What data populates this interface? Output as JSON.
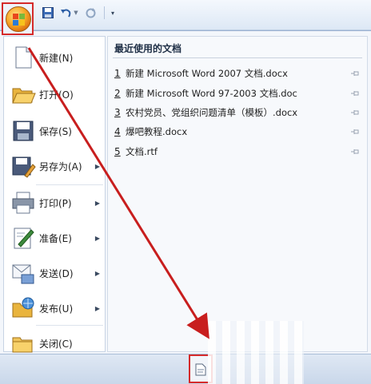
{
  "menu": {
    "items": [
      {
        "label": "新建(N)",
        "has_submenu": false
      },
      {
        "label": "打开(O)",
        "has_submenu": false
      },
      {
        "label": "保存(S)",
        "has_submenu": false
      },
      {
        "label": "另存为(A)",
        "has_submenu": true
      },
      {
        "label": "打印(P)",
        "has_submenu": true
      },
      {
        "label": "准备(E)",
        "has_submenu": true
      },
      {
        "label": "发送(D)",
        "has_submenu": true
      },
      {
        "label": "发布(U)",
        "has_submenu": true
      },
      {
        "label": "关闭(C)",
        "has_submenu": false
      }
    ]
  },
  "recent": {
    "title": "最近使用的文档",
    "files": [
      {
        "num": "1",
        "name": "新建 Microsoft Word 2007 文档.docx"
      },
      {
        "num": "2",
        "name": "新建 Microsoft Word 97-2003 文档.doc"
      },
      {
        "num": "3",
        "name": "农村党员、党组织问题清单（模板）.docx"
      },
      {
        "num": "4",
        "name": "爆吧教程.docx"
      },
      {
        "num": "5",
        "name": "文档.rtf"
      }
    ]
  },
  "colors": {
    "highlight_box": "#d52a2a",
    "arrow": "#c81e1e",
    "office_orb": "#f7a928"
  },
  "icons": {
    "office_button": "office-orb-icon",
    "save": "save-icon",
    "undo": "undo-icon",
    "redo": "redo-icon",
    "customize": "customize-qat-icon",
    "pin": "pin-icon",
    "status_doc": "document-view-icon"
  }
}
